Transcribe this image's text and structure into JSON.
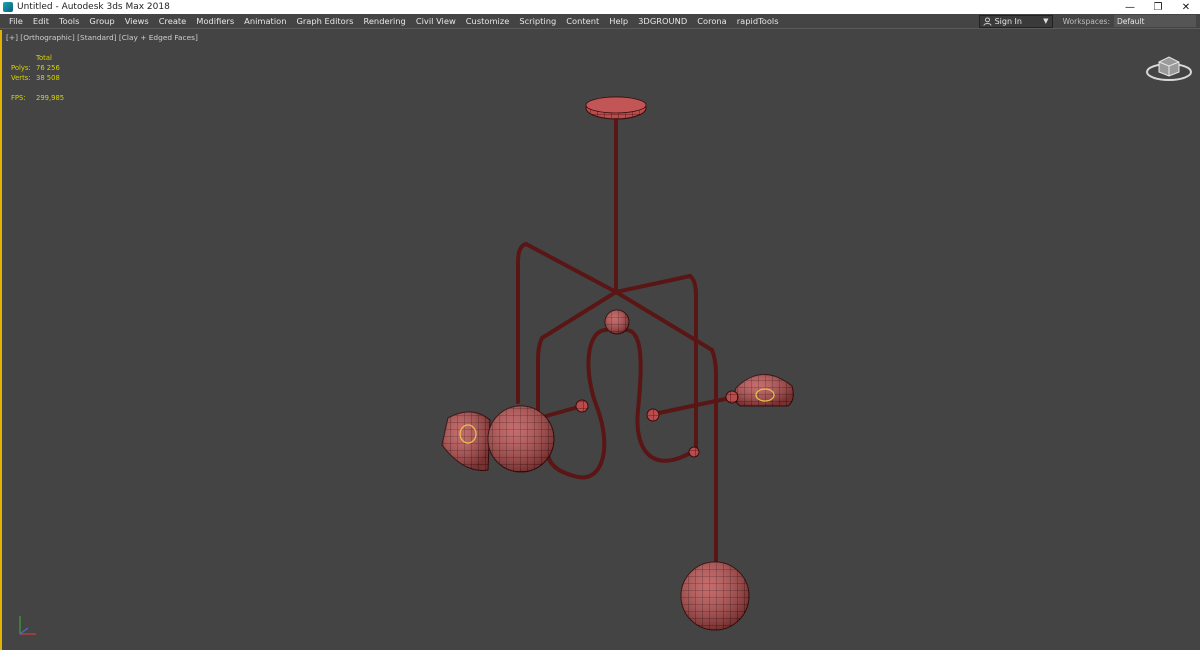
{
  "window": {
    "title": "Untitled - Autodesk 3ds Max 2018",
    "controls": [
      "—",
      "❐",
      "✕"
    ]
  },
  "menubar": {
    "items": [
      "File",
      "Edit",
      "Tools",
      "Group",
      "Views",
      "Create",
      "Modifiers",
      "Animation",
      "Graph Editors",
      "Rendering",
      "Civil View",
      "Customize",
      "Scripting",
      "Content",
      "Help",
      "3DGROUND",
      "Corona",
      "rapidTools"
    ],
    "sign_in": "Sign In",
    "workspaces_label": "Workspaces:",
    "workspace_value": "Default"
  },
  "viewport": {
    "label": "[+] [Orthographic] [Standard] [Clay + Edged Faces]",
    "stats": {
      "header": "Total",
      "polys_label": "Polys:",
      "polys_value": "76 256",
      "verts_label": "Verts:",
      "verts_value": "38 508",
      "fps_label": "FPS:",
      "fps_value": "299,985"
    }
  },
  "colors": {
    "viewport_bg": "#444444",
    "active_border": "#e0b300",
    "stats_text": "#d8d400",
    "model_fill": "#b94c4c",
    "model_wire": "#3a0b0b"
  },
  "icons": [
    "app-icon",
    "user-icon",
    "chevron-down-icon",
    "viewcube-icon",
    "axis-gizmo-icon"
  ]
}
